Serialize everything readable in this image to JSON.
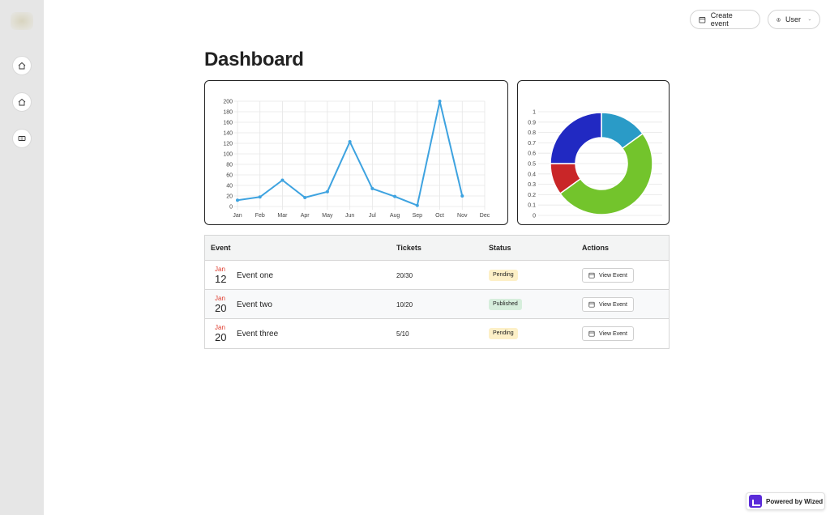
{
  "sidebar": {
    "items": [
      {
        "icon": "home-icon"
      },
      {
        "icon": "home-icon"
      },
      {
        "icon": "ticket-icon"
      }
    ]
  },
  "header": {
    "create_event_label": "Create event",
    "user_label": "User"
  },
  "page": {
    "title": "Dashboard"
  },
  "chart_data": [
    {
      "type": "line",
      "x": [
        "Jan",
        "Feb",
        "Mar",
        "Apr",
        "May",
        "Jun",
        "Jul",
        "Aug",
        "Sep",
        "Oct",
        "Nov",
        "Dec"
      ],
      "series": [
        {
          "values": [
            12,
            18,
            50,
            17,
            28,
            123,
            34,
            19,
            2,
            200,
            20,
            null
          ],
          "color": "#3ea3e0"
        }
      ],
      "ylim": [
        0,
        200
      ],
      "yticks": [
        "0",
        "20",
        "40",
        "60",
        "80",
        "100",
        "120",
        "140",
        "160",
        "180",
        "200"
      ],
      "grid": true
    },
    {
      "type": "pie",
      "variant": "doughnut",
      "values": [
        0.15,
        0.5,
        0.1,
        0.25
      ],
      "colors": [
        "#2a9bc7",
        "#73c42c",
        "#c92628",
        "#2129c2"
      ],
      "yticks": [
        "0",
        "0.1",
        "0.2",
        "0.3",
        "0.4",
        "0.5",
        "0.6",
        "0.7",
        "0.8",
        "0.9",
        "1"
      ],
      "grid": true
    }
  ],
  "table": {
    "headers": {
      "event": "Event",
      "tickets": "Tickets",
      "status": "Status",
      "actions": "Actions"
    },
    "rows": [
      {
        "month": "Jan",
        "day": "12",
        "name": "Event one",
        "tickets": "20/30",
        "status": "Pending",
        "action": "View Event"
      },
      {
        "month": "Jan",
        "day": "20",
        "name": "Event two",
        "tickets": "10/20",
        "status": "Published",
        "action": "View Event"
      },
      {
        "month": "Jan",
        "day": "20",
        "name": "Event three",
        "tickets": "5/10",
        "status": "Pending",
        "action": "View Event"
      }
    ]
  },
  "footer": {
    "powered_by": "Powered by Wized"
  }
}
